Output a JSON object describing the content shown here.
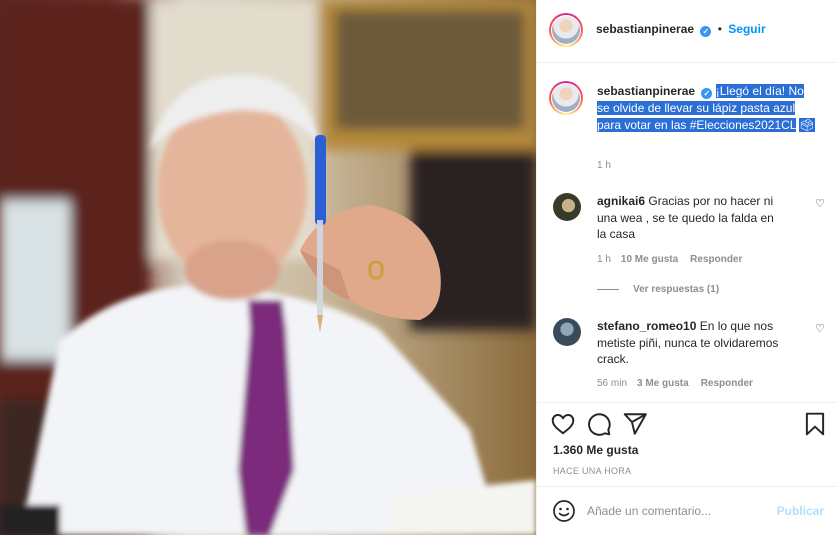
{
  "post": {
    "author": "sebastianpinerae",
    "follow_label": "Seguir",
    "dot": "•",
    "verified_mark": "✓"
  },
  "caption": {
    "author": "sebastianpinerae",
    "text": "¡Llegó el día! No se olvide de llevar su lápiz pasta azul para votar en las #Elecciones2021CL",
    "emoji": "🗳",
    "time": "1 h"
  },
  "comments": [
    {
      "author": "agnikai6",
      "text": "Gracias por no hacer ni una wea , se te quedo la falda en la casa",
      "time": "1 h",
      "likes": "10 Me gusta",
      "reply_label": "Responder",
      "view_replies": "Ver respuestas (1)"
    },
    {
      "author": "stefano_romeo10",
      "text": "En lo que nos metiste piñi, nunca te olvidaremos crack.",
      "time": "56 min",
      "likes": "3 Me gusta",
      "reply_label": "Responder"
    }
  ],
  "actions": {
    "likes": "1.360 Me gusta",
    "posted": "HACE UNA HORA"
  },
  "add_comment": {
    "placeholder": "Añade un comentario...",
    "publish_label": "Publicar"
  },
  "icons": {
    "like": "heart-outline-icon",
    "comment": "comment-bubble-icon",
    "share": "paper-plane-icon",
    "save": "bookmark-icon",
    "emoji": "smiley-icon",
    "comment_like": "small-heart-icon"
  },
  "colors": {
    "accent": "#0095f6",
    "selection": "#2b6ed6",
    "muted": "#8e8e8e",
    "publish_disabled": "#b2dffc"
  }
}
